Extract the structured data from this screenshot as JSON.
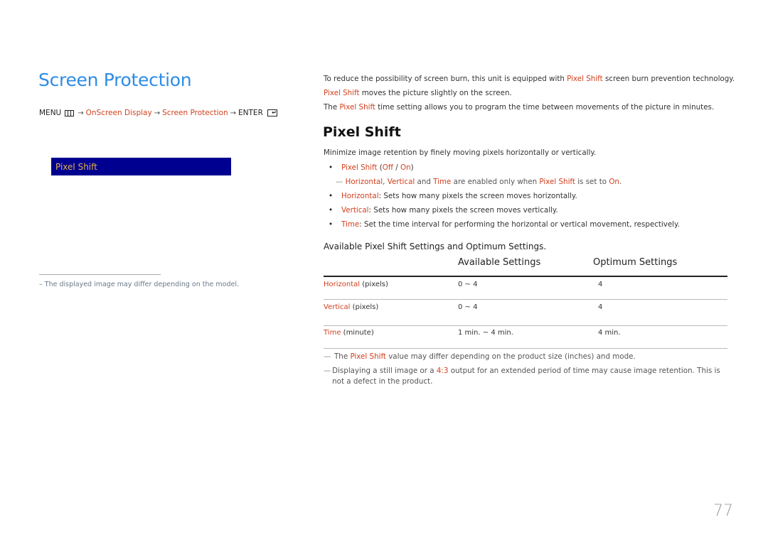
{
  "left": {
    "title": "Screen Protection",
    "menu_path": {
      "menu": "MENU",
      "menu_icon": "menu-grid-icon",
      "arrow": "→",
      "step1": "OnScreen Display",
      "step2": "Screen Protection",
      "enter": "ENTER",
      "enter_icon": "enter-icon"
    },
    "osd_item": "Pixel Shift",
    "footnote": "–  The displayed image may differ depending on the model."
  },
  "intro": {
    "line1_a": "To reduce the possibility of screen burn, this unit is equipped with ",
    "line1_hl": "Pixel Shift",
    "line1_b": " screen burn prevention technology.",
    "line2_hl": "Pixel Shift",
    "line2_b": " moves the picture slightly on the screen.",
    "line3_a": "The ",
    "line3_hl": "Pixel Shift",
    "line3_b": " time setting allows you to program the time between movements of the picture in minutes."
  },
  "section": {
    "title": "Pixel Shift",
    "description": "Minimize image retention by finely moving pixels horizontally or vertically.",
    "bullets": {
      "b1_name": "Pixel Shift",
      "b1_open": " (",
      "b1_off": "Off",
      "b1_sep": " / ",
      "b1_on": "On",
      "b1_close": ")",
      "note_dash": "—",
      "note_h": "Horizontal",
      "note_c1": ", ",
      "note_v": "Vertical",
      "note_and": " and ",
      "note_t": "Time",
      "note_mid": " are enabled only when ",
      "note_ps": "Pixel Shift",
      "note_set": " is set to ",
      "note_on": "On",
      "note_end": ".",
      "b2_name": "Horizontal",
      "b2_text": ": Sets how many pixels the screen moves horizontally.",
      "b3_name": "Vertical",
      "b3_text": ": Sets how many pixels the screen moves vertically.",
      "b4_name": "Time",
      "b4_text": ": Set the time interval for performing the horizontal or vertical movement, respectively.",
      "dot": "•"
    }
  },
  "table": {
    "heading": "Available Pixel Shift Settings and Optimum Settings.",
    "col_available": "Available Settings",
    "col_optimum": "Optimum Settings",
    "rows": [
      {
        "name": "Horizontal",
        "unit": " (pixels)",
        "available": "0 ~ 4",
        "optimum": "4"
      },
      {
        "name": "Vertical",
        "unit": " (pixels)",
        "available": "0 ~ 4",
        "optimum": "4"
      },
      {
        "name": "Time",
        "unit": " (minute)",
        "available": "1 min. ~ 4 min.",
        "optimum": "4 min."
      }
    ]
  },
  "notes": {
    "dash": "—",
    "n1_a": "The ",
    "n1_hl": "Pixel Shift",
    "n1_b": " value may differ depending on the product size (inches) and mode.",
    "n2_a": "Displaying a still image or a ",
    "n2_hl": "4:3",
    "n2_b": " output for an extended period of time may cause image retention. This is not a defect in the product."
  },
  "page_number": "77",
  "colors": {
    "title_blue": "#2d8ce6",
    "highlight_red": "#d2411f",
    "osd_background": "#000090",
    "osd_text": "#e3b24a"
  }
}
